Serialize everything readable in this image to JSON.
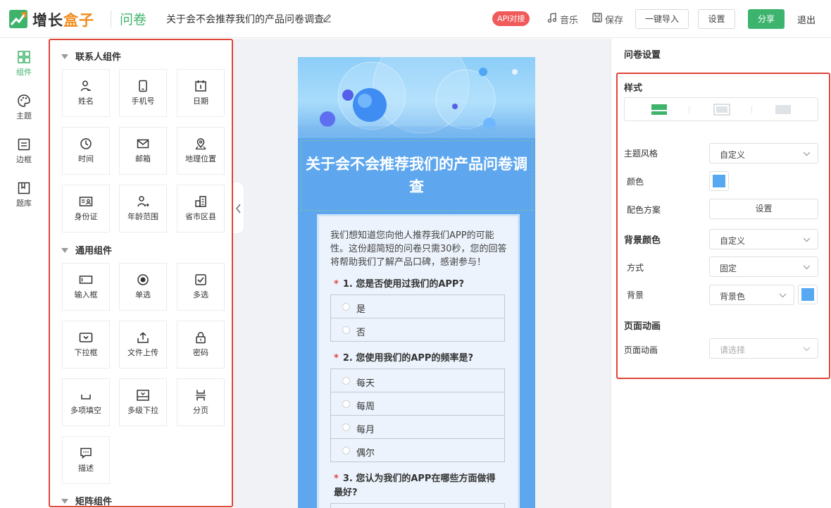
{
  "header": {
    "logo_text_a": "增长",
    "logo_text_b": "盒子",
    "product": "问卷",
    "doc_title": "关于会不会推荐我们的产品问卷调查",
    "api_badge": "API对接",
    "music": "音乐",
    "save": "保存",
    "import": "一键导入",
    "settings": "设置",
    "share": "分享",
    "logout": "退出"
  },
  "rail": [
    {
      "label": "组件",
      "icon": "grid-icon"
    },
    {
      "label": "主题",
      "icon": "palette-icon"
    },
    {
      "label": "边框",
      "icon": "border-icon"
    },
    {
      "label": "题库",
      "icon": "library-icon"
    }
  ],
  "components": {
    "contact_title": "联系人组件",
    "contact": [
      "姓名",
      "手机号",
      "日期",
      "时间",
      "邮箱",
      "地理位置",
      "身份证",
      "年龄范围",
      "省市区县"
    ],
    "general_title": "通用组件",
    "general": [
      "输入框",
      "单选",
      "多选",
      "下拉框",
      "文件上传",
      "密码",
      "多项填空",
      "多级下拉",
      "分页",
      "描述"
    ],
    "matrix_title": "矩阵组件"
  },
  "survey": {
    "title": "关于会不会推荐我们的产品问卷调查",
    "intro": "我们想知道您向他人推荐我们APP的可能性。这份超简短的问卷只需30秒，您的回答将帮助我们了解产品口碑，感谢参与！",
    "q1": "1. 您是否使用过我们的APP?",
    "q1_opts": [
      "是",
      "否"
    ],
    "q2": "2. 您使用我们的APP的频率是?",
    "q2_opts": [
      "每天",
      "每周",
      "每月",
      "偶尔"
    ],
    "q3": "3. 您认为我们的APP在哪些方面做得最好?"
  },
  "settings": {
    "panel_title": "问卷设置",
    "style_label": "样式",
    "theme_style_label": "主题风格",
    "theme_style_value": "自定义",
    "color_label": "颜色",
    "color_value": "#56a8f0",
    "scheme_label": "配色方案",
    "scheme_button": "设置",
    "bg_color_label": "背景颜色",
    "bg_color_value": "自定义",
    "mode_label": "方式",
    "mode_value": "固定",
    "bg_label": "背景",
    "bg_value": "背景色",
    "anim_section": "页面动画",
    "anim_label": "页面动画",
    "anim_placeholder": "请选择"
  },
  "colors": {
    "brand_green": "#3fb36b",
    "brand_orange": "#f08c1e",
    "highlight_red": "#e0453a",
    "phone_blue": "#5ea7ee"
  }
}
